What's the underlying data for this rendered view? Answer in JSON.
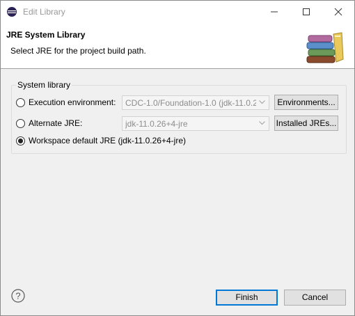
{
  "window": {
    "title": "Edit Library"
  },
  "banner": {
    "title": "JRE System Library",
    "description": "Select JRE for the project build path.",
    "icon": "library-books-icon"
  },
  "group": {
    "label": "System library",
    "execution_env": {
      "label": "Execution environment:",
      "value": "CDC-1.0/Foundation-1.0 (jdk-11.0.2",
      "button": "Environments...",
      "selected": false
    },
    "alternate_jre": {
      "label": "Alternate JRE:",
      "value": "jdk-11.0.26+4-jre",
      "button": "Installed JREs...",
      "selected": false
    },
    "workspace_default": {
      "label": "Workspace default JRE (jdk-11.0.26+4-jre)",
      "selected": true
    }
  },
  "footer": {
    "finish": "Finish",
    "cancel": "Cancel",
    "help_icon": "help-icon"
  },
  "colors": {
    "default_button_border": "#0078d7",
    "dialog_bg": "#f0f0f0",
    "banner_bg": "#ffffff"
  }
}
